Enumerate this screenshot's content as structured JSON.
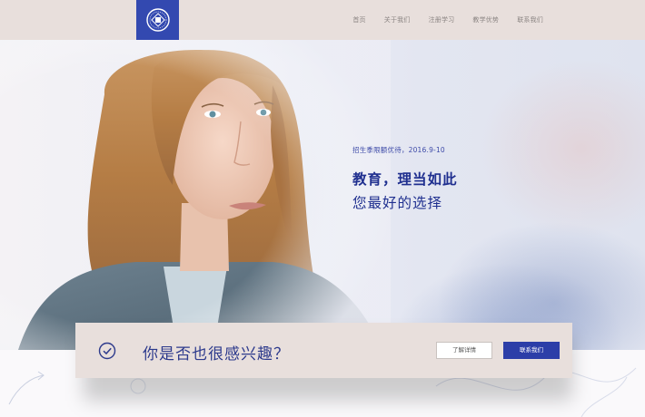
{
  "header": {
    "nav": [
      {
        "label": "首页"
      },
      {
        "label": "关于我们"
      },
      {
        "label": "注册学习"
      },
      {
        "label": "教学优势"
      },
      {
        "label": "联系我们"
      }
    ]
  },
  "hero": {
    "subtitle": "招生季限额优待，2016.9-10",
    "title": "教育，理当如此",
    "title2": "您最好的选择"
  },
  "cta": {
    "question": "你是否也很感兴趣？",
    "details_label": "了解详情",
    "contact_label": "联系我们"
  },
  "colors": {
    "accent": "#2c3ea8",
    "header_bg": "#e8dfdc",
    "title_text": "#1f2f8f"
  },
  "icons": {
    "logo": "emblem-logo",
    "cta": "check-circle-icon"
  }
}
